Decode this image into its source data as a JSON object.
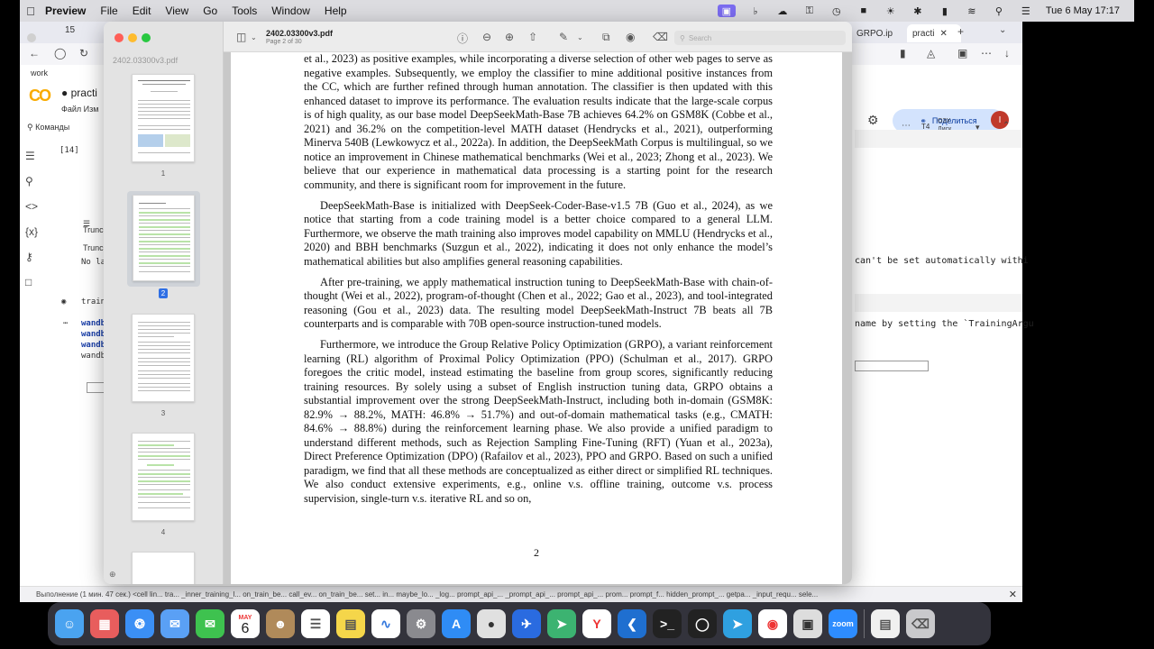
{
  "menubar": {
    "app_name": "Preview",
    "menus": [
      "File",
      "Edit",
      "View",
      "Go",
      "Tools",
      "Window",
      "Help"
    ],
    "clock": "Tue 6 May  17:17"
  },
  "browser": {
    "tab_count": "15",
    "tabs": [
      "GRPO.ip",
      "practi"
    ],
    "workspace": "work",
    "colab": {
      "logo": "CO",
      "title": "practi",
      "file_menu": "Файл  Изм",
      "commands": "Команды",
      "cell_label": "[14]",
      "truncated_1": "Trunca",
      "truncated_2": "Trunca",
      "no_la": "No la",
      "train": "train",
      "wandb_lines": [
        "wandb",
        "wandb",
        "wandb",
        "wandb"
      ],
      "share_label": "Поделиться",
      "avatar_letter": "I",
      "runtime": "T4",
      "ram": "ОЗУ",
      "disk": "Диск",
      "right_text_1": "can't be set automatically withi",
      "right_text_2": "name by setting the `TrainingArgu",
      "status_text": "Выполнение (1 мин. 47 сек.)   <cell lin...   tra...   _inner_training_l...   on_train_be...   call_ev...   on_train_be...   set...   in...   maybe_lo...   _log...   prompt_api_...   _prompt_api_...   prompt_api_...   prom...   prompt_f...   hidden_prompt_...   getpa...   _input_requ...   sele..."
    }
  },
  "preview": {
    "sidebar_filename": "2402.03300v3.pdf",
    "thumbnails": [
      {
        "label": "1"
      },
      {
        "label": "2",
        "selected": true
      },
      {
        "label": "3"
      },
      {
        "label": "4"
      }
    ],
    "doc_title": "2402.03300v3.pdf",
    "doc_subtitle": "Page 2 of 30",
    "search_placeholder": "Search",
    "page_number": "2",
    "paragraphs": [
      "et al., 2023) as positive examples, while incorporating a diverse selection of other web pages to serve as negative examples. Subsequently, we employ the classifier to mine additional positive instances from the CC, which are further refined through human annotation. The classifier is then updated with this enhanced dataset to improve its performance. The evaluation results indicate that the large-scale corpus is of high quality, as our base model DeepSeekMath-Base 7B achieves 64.2% on GSM8K (Cobbe et al., 2021) and 36.2% on the competition-level MATH dataset (Hendrycks et al., 2021), outperforming Minerva 540B (Lewkowycz et al., 2022a). In addition, the DeepSeekMath Corpus is multilingual, so we notice an improvement in Chinese mathematical benchmarks (Wei et al., 2023; Zhong et al., 2023). We believe that our experience in mathematical data processing is a starting point for the research community, and there is significant room for improvement in the future.",
      "DeepSeekMath-Base is initialized with DeepSeek-Coder-Base-v1.5 7B (Guo et al., 2024), as we notice that starting from a code training model is a better choice compared to a general LLM. Furthermore, we observe the math training also improves model capability on MMLU (Hendrycks et al., 2020) and BBH benchmarks (Suzgun et al., 2022), indicating it does not only enhance the model’s mathematical abilities but also amplifies general reasoning capabilities.",
      "After pre-training, we apply mathematical instruction tuning to DeepSeekMath-Base with chain-of-thought (Wei et al., 2022), program-of-thought (Chen et al., 2022; Gao et al., 2023), and tool-integrated reasoning (Gou et al., 2023) data. The resulting model DeepSeekMath-Instruct 7B beats all 7B counterparts and is comparable with 70B open-source instruction-tuned models.",
      "Furthermore, we introduce the Group Relative Policy Optimization (GRPO), a variant reinforcement learning (RL) algorithm of Proximal Policy Optimization (PPO) (Schulman et al., 2017). GRPO foregoes the critic model, instead estimating the baseline from group scores, significantly reducing training resources. By solely using a subset of English instruction tuning data, GRPO obtains a substantial improvement over the strong DeepSeekMath-Instruct, including both in-domain (GSM8K: 82.9% → 88.2%, MATH: 46.8% → 51.7%) and out-of-domain mathematical tasks (e.g., CMATH: 84.6% → 88.8%) during the reinforcement learning phase. We also provide a unified paradigm to understand different methods, such as Rejection Sampling Fine-Tuning (RFT) (Yuan et al., 2023a), Direct Preference Optimization (DPO) (Rafailov et al., 2023), PPO and GRPO. Based on such a unified paradigm, we find that all these methods are conceptualized as either direct or simplified RL techniques. We also conduct extensive experiments, e.g., online v.s. offline training, outcome v.s. process supervision, single-turn v.s. iterative RL and so on,"
    ]
  },
  "dock": {
    "calendar_month": "MAY",
    "calendar_day": "6",
    "zoom_label": "zoom"
  }
}
